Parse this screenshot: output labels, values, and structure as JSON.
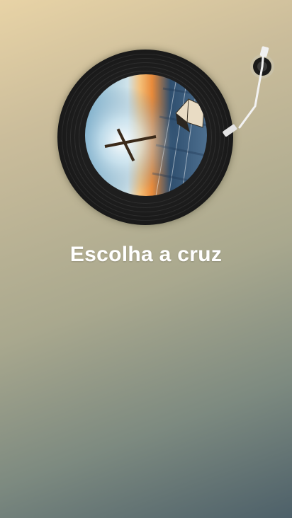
{
  "screen": {
    "title": "Escolha a cruz"
  },
  "player": {
    "record_art": "cross-over-ocean-sunset-with-open-bible",
    "tonearm_icon": "tonearm-icon"
  },
  "colors": {
    "background_top": "#e8d3a6",
    "background_bottom": "#4d6069",
    "title_text": "#ffffff",
    "record": "#1c1c1c"
  }
}
